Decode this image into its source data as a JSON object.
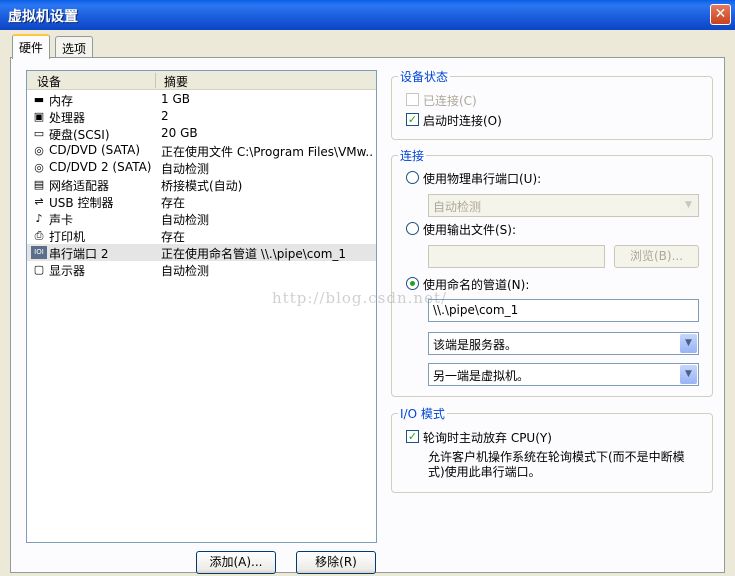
{
  "window": {
    "title": "虚拟机设置",
    "close_glyph": "✕"
  },
  "tabs": [
    {
      "label": "硬件",
      "active": true
    },
    {
      "label": "选项",
      "active": false
    }
  ],
  "device_list": {
    "headers": {
      "device": "设备",
      "summary": "摘要"
    },
    "rows": [
      {
        "icon": "memory-icon",
        "glyph": "▬",
        "name": "内存",
        "summary": "1 GB"
      },
      {
        "icon": "processor-icon",
        "glyph": "▣",
        "name": "处理器",
        "summary": "2"
      },
      {
        "icon": "harddisk-icon",
        "glyph": "▭",
        "name": "硬盘(SCSI)",
        "summary": "20 GB"
      },
      {
        "icon": "cd-dvd-icon",
        "glyph": "◎",
        "name": "CD/DVD (SATA)",
        "summary": "正在使用文件 C:\\Program Files\\VMw..."
      },
      {
        "icon": "cd-dvd-icon",
        "glyph": "◎",
        "name": "CD/DVD 2 (SATA)",
        "summary": "自动检测"
      },
      {
        "icon": "network-adapter-icon",
        "glyph": "▤",
        "name": "网络适配器",
        "summary": "桥接模式(自动)"
      },
      {
        "icon": "usb-icon",
        "glyph": "⇌",
        "name": "USB 控制器",
        "summary": "存在"
      },
      {
        "icon": "sound-card-icon",
        "glyph": "♪",
        "name": "声卡",
        "summary": "自动检测"
      },
      {
        "icon": "printer-icon",
        "glyph": "⎙",
        "name": "打印机",
        "summary": "存在"
      },
      {
        "icon": "serial-port-icon",
        "glyph": "IOI",
        "name": "串行端口 2",
        "summary": "正在使用命名管道 \\\\.\\pipe\\com_1",
        "selected": true
      },
      {
        "icon": "display-icon",
        "glyph": "▢",
        "name": "显示器",
        "summary": "自动检测"
      }
    ]
  },
  "buttons": {
    "add": "添加(A)...",
    "remove": "移除(R)"
  },
  "device_status": {
    "title": "设备状态",
    "connected": {
      "label": "已连接(C)",
      "checked": false,
      "enabled": false
    },
    "connect_at_power_on": {
      "label": "启动时连接(O)",
      "checked": true
    }
  },
  "connection": {
    "title": "连接",
    "physical_port": {
      "label": "使用物理串行端口(U):",
      "selected": false
    },
    "physical_port_dropdown": {
      "value": "自动检测",
      "enabled": false
    },
    "output_file": {
      "label": "使用输出文件(S):",
      "selected": false
    },
    "output_file_field": {
      "value": "",
      "enabled": false
    },
    "browse_button": {
      "label": "浏览(B)...",
      "enabled": false
    },
    "named_pipe": {
      "label": "使用命名的管道(N):",
      "selected": true
    },
    "pipe_name": "\\\\.\\pipe\\com_1",
    "this_end": "该端是服务器。",
    "other_end": "另一端是虚拟机。"
  },
  "io_mode": {
    "title": "I/O 模式",
    "yield_cpu": {
      "label": "轮询时主动放弃 CPU(Y)",
      "checked": true
    },
    "description": "允许客户机操作系统在轮询模式下(而不是中断模式)使用此串行端口。"
  },
  "watermark": "http://blog.csdn.net/",
  "colors": {
    "titlebar": "#0A5FE6",
    "group_title": "#0046D5",
    "check": "#21A121",
    "panel": "#FCFCFE",
    "window": "#ECE9D8"
  }
}
